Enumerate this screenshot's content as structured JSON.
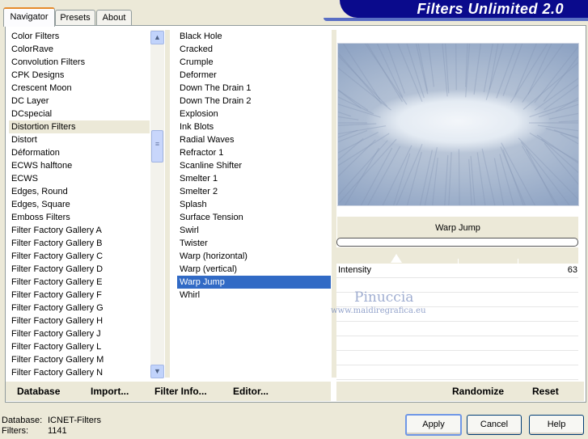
{
  "banner_title": "Filters Unlimited 2.0",
  "tabs": [
    "Navigator",
    "Presets",
    "About"
  ],
  "categories": [
    "Color Filters",
    "ColorRave",
    "Convolution Filters",
    "CPK Designs",
    "Crescent Moon",
    "DC Layer",
    "DCspecial",
    "Distortion Filters",
    "Distort",
    "Déformation",
    "ECWS halftone",
    "ECWS",
    "Edges, Round",
    "Edges, Square",
    "Emboss Filters",
    "Filter Factory Gallery A",
    "Filter Factory Gallery B",
    "Filter Factory Gallery C",
    "Filter Factory Gallery D",
    "Filter Factory Gallery E",
    "Filter Factory Gallery F",
    "Filter Factory Gallery G",
    "Filter Factory Gallery H",
    "Filter Factory Gallery J",
    "Filter Factory Gallery L",
    "Filter Factory Gallery M",
    "Filter Factory Gallery N"
  ],
  "selected_category_index": 7,
  "filters": [
    "Black Hole",
    "Cracked",
    "Crumple",
    "Deformer",
    "Down The Drain 1",
    "Down The Drain 2",
    "Explosion",
    "Ink Blots",
    "Radial Waves",
    "Refractor 1",
    "Scanline Shifter",
    "Smelter 1",
    "Smelter 2",
    "Splash",
    "Surface Tension",
    "Swirl",
    "Twister",
    "Warp (horizontal)",
    "Warp (vertical)",
    "Warp Jump",
    "Whirl"
  ],
  "selected_filter_index": 19,
  "filter_title": "Warp Jump",
  "param": {
    "name": "Intensity",
    "value": "63"
  },
  "watermark": {
    "name": "Pinuccia",
    "url": "www.maidiregrafica.eu"
  },
  "left_links": {
    "database": "Database",
    "import": "Import...",
    "filter_info": "Filter Info...",
    "editor": "Editor..."
  },
  "right_links": {
    "randomize": "Randomize",
    "reset": "Reset"
  },
  "info": {
    "database_label": "Database:",
    "database_value": "ICNET-Filters",
    "filters_label": "Filters:",
    "filters_value": "1141"
  },
  "buttons": {
    "apply": "Apply",
    "cancel": "Cancel",
    "help": "Help"
  },
  "icons": {
    "scroll_up": "▲",
    "scroll_down": "▼",
    "thumb_grip": "≡"
  }
}
